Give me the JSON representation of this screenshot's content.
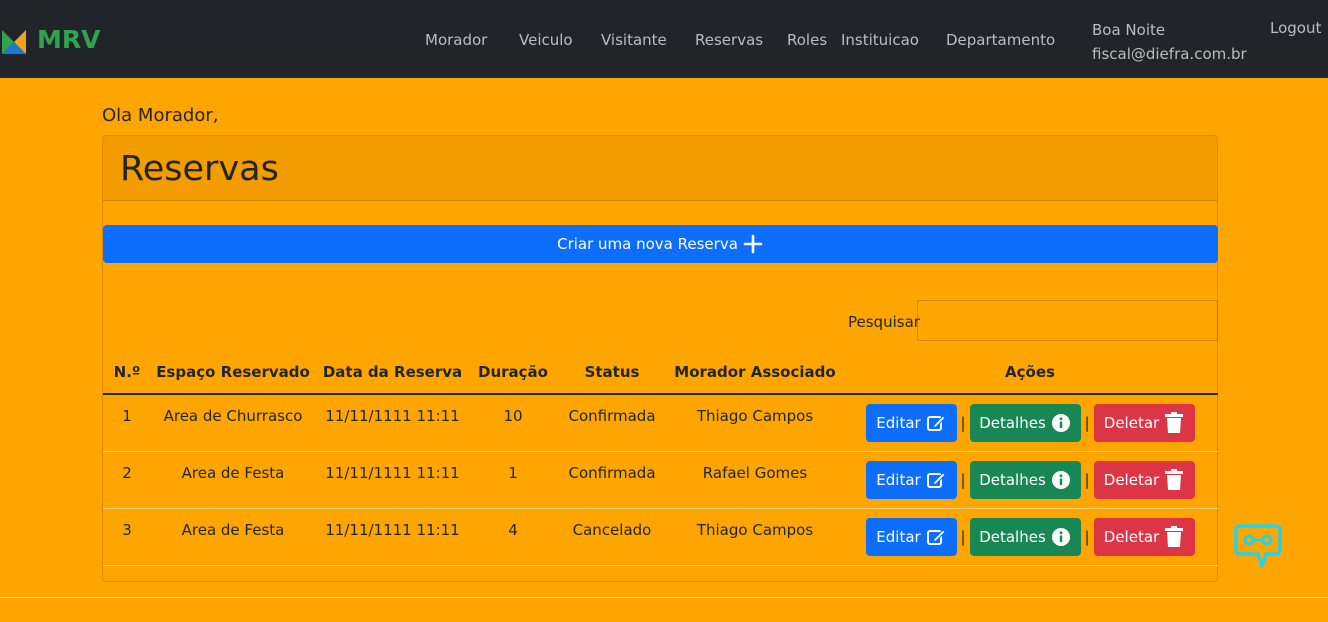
{
  "brand": {
    "name": "MRV",
    "colors": {
      "green": "#2ea44f",
      "orange": "#f7a21b",
      "blue": "#1e88e5"
    }
  },
  "nav": {
    "links": [
      "Morador",
      "Veiculo",
      "Visitante",
      "Reservas",
      "Roles",
      "Instituicao",
      "Departamento"
    ],
    "greeting": "Boa Noite",
    "email": "fiscal@diefra.com.br",
    "logout": "Logout"
  },
  "page": {
    "greeting": "Ola Morador,",
    "title": "Reservas",
    "create_button": "Criar uma nova Reserva",
    "search_label": "Pesquisar",
    "search_value": ""
  },
  "table": {
    "columns": [
      "N.º",
      "Espaço Reservado",
      "Data da Reserva",
      "Duração",
      "Status",
      "Morador Associado",
      "Ações"
    ],
    "rows": [
      {
        "n": "1",
        "espaco": "Area de Churrasco",
        "data": "11/11/1111 11:11",
        "duracao": "10",
        "status": "Confirmada",
        "morador": "Thiago Campos"
      },
      {
        "n": "2",
        "espaco": "Area de Festa",
        "data": "11/11/1111 11:11",
        "duracao": "1",
        "status": "Confirmada",
        "morador": "Rafael Gomes"
      },
      {
        "n": "3",
        "espaco": "Area de Festa",
        "data": "11/11/1111 11:11",
        "duracao": "4",
        "status": "Cancelado",
        "morador": "Thiago Campos"
      }
    ],
    "actions": {
      "edit": "Editar",
      "details": "Detalhes",
      "delete": "Deletar",
      "separator": "|"
    }
  },
  "theme": {
    "navbar_bg": "#212529",
    "page_bg": "#ffa500",
    "primary": "#0d6efd",
    "success": "#198754",
    "danger": "#dc3545"
  },
  "icons": {
    "create": "plus-icon",
    "edit": "pencil-square-icon",
    "details": "info-circle-icon",
    "delete": "trash-icon",
    "widget": "chat-bot-icon"
  }
}
